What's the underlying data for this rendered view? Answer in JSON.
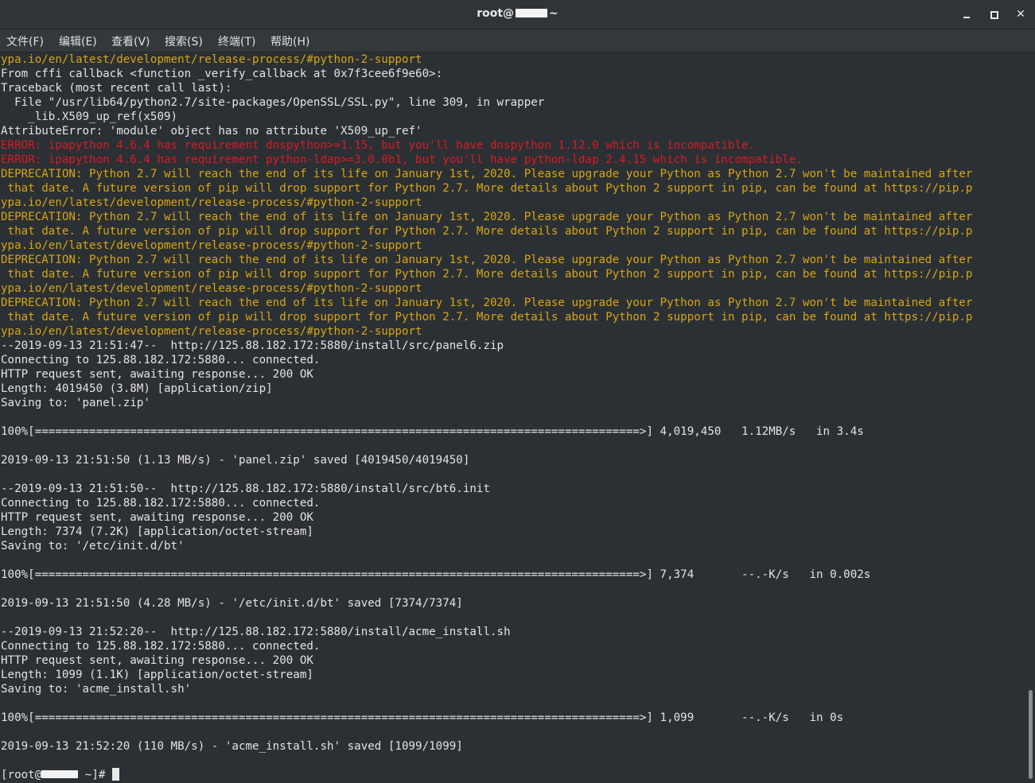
{
  "window": {
    "title_prefix": "root@",
    "title_suffix": "~"
  },
  "menu": [
    {
      "label": "文件(F)",
      "name": "menu-file"
    },
    {
      "label": "编辑(E)",
      "name": "menu-edit"
    },
    {
      "label": "查看(V)",
      "name": "menu-view"
    },
    {
      "label": "搜索(S)",
      "name": "menu-search"
    },
    {
      "label": "终端(T)",
      "name": "menu-terminal"
    },
    {
      "label": "帮助(H)",
      "name": "menu-help"
    }
  ],
  "colors": {
    "default": "#e3e3e3",
    "warning": "#d7a613",
    "error": "#d81b23",
    "background": "#2b3035"
  },
  "terminal": {
    "lines": [
      {
        "c": "yellow",
        "t": "ypa.io/en/latest/development/release-process/#python-2-support"
      },
      {
        "c": "default",
        "t": "From cffi callback <function _verify_callback at 0x7f3cee6f9e60>:"
      },
      {
        "c": "default",
        "t": "Traceback (most recent call last):"
      },
      {
        "c": "default",
        "t": "  File \"/usr/lib64/python2.7/site-packages/OpenSSL/SSL.py\", line 309, in wrapper"
      },
      {
        "c": "default",
        "t": "    _lib.X509_up_ref(x509)"
      },
      {
        "c": "default",
        "t": "AttributeError: 'module' object has no attribute 'X509_up_ref'"
      },
      {
        "c": "red",
        "t": "ERROR: ipapython 4.6.4 has requirement dnspython>=1.15, but you'll have dnspython 1.12.0 which is incompatible."
      },
      {
        "c": "red",
        "t": "ERROR: ipapython 4.6.4 has requirement python-ldap>=3.0.0b1, but you'll have python-ldap 2.4.15 which is incompatible."
      },
      {
        "c": "yellow",
        "t": "DEPRECATION: Python 2.7 will reach the end of its life on January 1st, 2020. Please upgrade your Python as Python 2.7 won't be maintained after"
      },
      {
        "c": "yellow",
        "t": " that date. A future version of pip will drop support for Python 2.7. More details about Python 2 support in pip, can be found at https://pip.p"
      },
      {
        "c": "yellow",
        "t": "ypa.io/en/latest/development/release-process/#python-2-support"
      },
      {
        "c": "yellow",
        "t": "DEPRECATION: Python 2.7 will reach the end of its life on January 1st, 2020. Please upgrade your Python as Python 2.7 won't be maintained after"
      },
      {
        "c": "yellow",
        "t": " that date. A future version of pip will drop support for Python 2.7. More details about Python 2 support in pip, can be found at https://pip.p"
      },
      {
        "c": "yellow",
        "t": "ypa.io/en/latest/development/release-process/#python-2-support"
      },
      {
        "c": "yellow",
        "t": "DEPRECATION: Python 2.7 will reach the end of its life on January 1st, 2020. Please upgrade your Python as Python 2.7 won't be maintained after"
      },
      {
        "c": "yellow",
        "t": " that date. A future version of pip will drop support for Python 2.7. More details about Python 2 support in pip, can be found at https://pip.p"
      },
      {
        "c": "yellow",
        "t": "ypa.io/en/latest/development/release-process/#python-2-support"
      },
      {
        "c": "yellow",
        "t": "DEPRECATION: Python 2.7 will reach the end of its life on January 1st, 2020. Please upgrade your Python as Python 2.7 won't be maintained after"
      },
      {
        "c": "yellow",
        "t": " that date. A future version of pip will drop support for Python 2.7. More details about Python 2 support in pip, can be found at https://pip.p"
      },
      {
        "c": "yellow",
        "t": "ypa.io/en/latest/development/release-process/#python-2-support"
      },
      {
        "c": "default",
        "t": "--2019-09-13 21:51:47--  http://125.88.182.172:5880/install/src/panel6.zip"
      },
      {
        "c": "default",
        "t": "Connecting to 125.88.182.172:5880... connected."
      },
      {
        "c": "default",
        "t": "HTTP request sent, awaiting response... 200 OK"
      },
      {
        "c": "default",
        "t": "Length: 4019450 (3.8M) [application/zip]"
      },
      {
        "c": "default",
        "t": "Saving to: 'panel.zip'"
      },
      {
        "c": "default",
        "t": ""
      },
      {
        "c": "default",
        "t": "100%[=========================================================================================>] 4,019,450   1.12MB/s   in 3.4s"
      },
      {
        "c": "default",
        "t": ""
      },
      {
        "c": "default",
        "t": "2019-09-13 21:51:50 (1.13 MB/s) - 'panel.zip' saved [4019450/4019450]"
      },
      {
        "c": "default",
        "t": ""
      },
      {
        "c": "default",
        "t": "--2019-09-13 21:51:50--  http://125.88.182.172:5880/install/src/bt6.init"
      },
      {
        "c": "default",
        "t": "Connecting to 125.88.182.172:5880... connected."
      },
      {
        "c": "default",
        "t": "HTTP request sent, awaiting response... 200 OK"
      },
      {
        "c": "default",
        "t": "Length: 7374 (7.2K) [application/octet-stream]"
      },
      {
        "c": "default",
        "t": "Saving to: '/etc/init.d/bt'"
      },
      {
        "c": "default",
        "t": ""
      },
      {
        "c": "default",
        "t": "100%[=========================================================================================>] 7,374       --.-K/s   in 0.002s"
      },
      {
        "c": "default",
        "t": ""
      },
      {
        "c": "default",
        "t": "2019-09-13 21:51:50 (4.28 MB/s) - '/etc/init.d/bt' saved [7374/7374]"
      },
      {
        "c": "default",
        "t": ""
      },
      {
        "c": "default",
        "t": "--2019-09-13 21:52:20--  http://125.88.182.172:5880/install/acme_install.sh"
      },
      {
        "c": "default",
        "t": "Connecting to 125.88.182.172:5880... connected."
      },
      {
        "c": "default",
        "t": "HTTP request sent, awaiting response... 200 OK"
      },
      {
        "c": "default",
        "t": "Length: 1099 (1.1K) [application/octet-stream]"
      },
      {
        "c": "default",
        "t": "Saving to: 'acme_install.sh'"
      },
      {
        "c": "default",
        "t": ""
      },
      {
        "c": "default",
        "t": "100%[=========================================================================================>] 1,099       --.-K/s   in 0s"
      },
      {
        "c": "default",
        "t": ""
      },
      {
        "c": "default",
        "t": "2019-09-13 21:52:20 (110 MB/s) - 'acme_install.sh' saved [1099/1099]"
      },
      {
        "c": "default",
        "t": ""
      }
    ],
    "prompt_prefix": "[root@",
    "prompt_suffix": " ~]# "
  }
}
